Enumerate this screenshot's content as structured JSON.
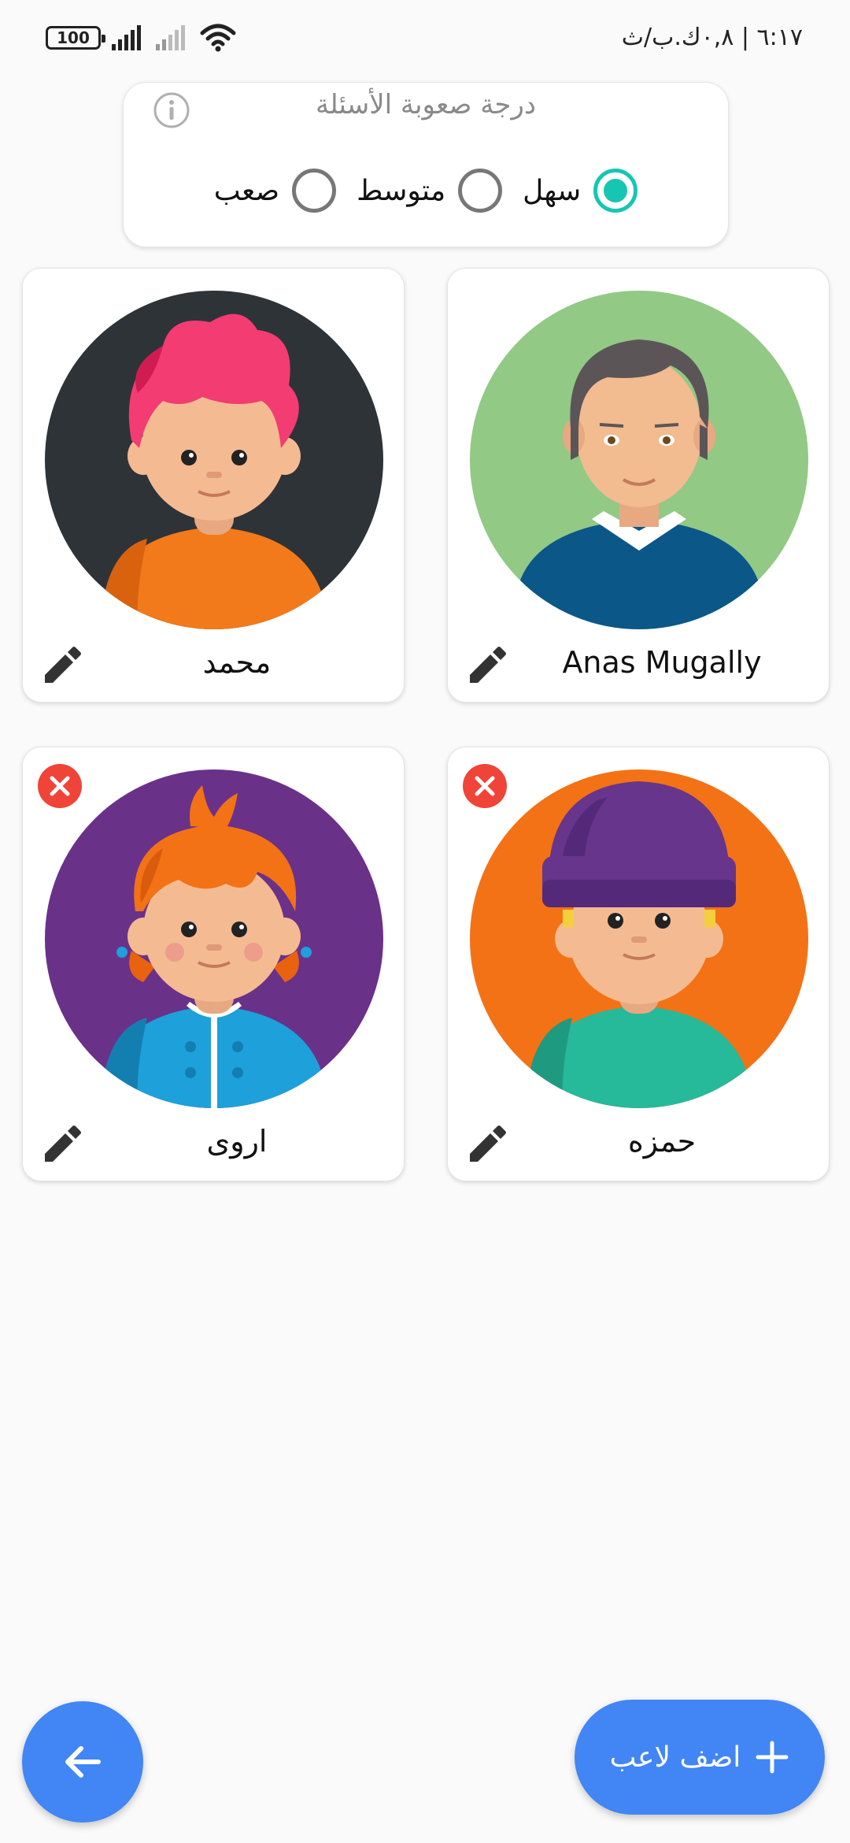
{
  "status_bar": {
    "battery": "100",
    "time": "٦:١٧ | ٠,٨ك.ب/ث"
  },
  "difficulty": {
    "title": "درجة صعوبة الأسئلة",
    "options": [
      {
        "label": "سهل",
        "selected": true
      },
      {
        "label": "متوسط",
        "selected": false
      },
      {
        "label": "صعب",
        "selected": false
      }
    ],
    "accent_color": "#17c6b2"
  },
  "players": [
    {
      "name": "Anas Mugally",
      "avatar": "man-sweater-avatar",
      "deletable": false
    },
    {
      "name": "محمد",
      "avatar": "boy-pink-hair-avatar",
      "deletable": false
    },
    {
      "name": "حمزه",
      "avatar": "boy-beanie-avatar",
      "deletable": true
    },
    {
      "name": "اروى",
      "avatar": "girl-orange-hair-avatar",
      "deletable": true
    }
  ],
  "buttons": {
    "add_player": "اضف لاعب",
    "primary_color": "#4285f4",
    "delete_color": "#f04438"
  }
}
